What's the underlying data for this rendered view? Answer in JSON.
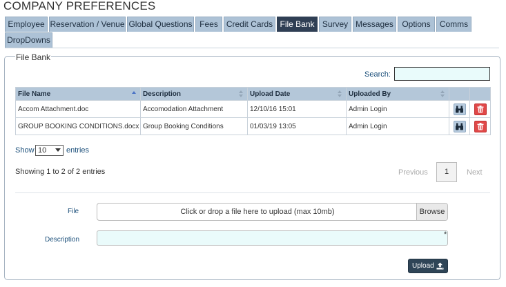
{
  "page_title": "COMPANY PREFERENCES",
  "tabs": [
    {
      "label": "Employee",
      "active": false
    },
    {
      "label": "Reservation / Venue",
      "active": false
    },
    {
      "label": "Global Questions",
      "active": false
    },
    {
      "label": "Fees",
      "active": false
    },
    {
      "label": "Credit Cards",
      "active": false
    },
    {
      "label": "File Bank",
      "active": true
    },
    {
      "label": "Survey",
      "active": false
    },
    {
      "label": "Messages",
      "active": false
    },
    {
      "label": "Options",
      "active": false
    },
    {
      "label": "Comms",
      "active": false
    },
    {
      "label": "DropDowns",
      "active": false
    }
  ],
  "panel": {
    "legend": "File Bank",
    "search": {
      "label": "Search:",
      "value": ""
    },
    "table": {
      "columns": [
        "File Name",
        "Description",
        "Upload Date",
        "Uploaded By"
      ],
      "sorted_column": "File Name",
      "sort_direction": "ascending",
      "rows": [
        {
          "file_name": "Accom Attachment.doc",
          "description": "Accomodation Attachment",
          "upload_date": "12/10/16 15:01",
          "uploaded_by": "Admin Login",
          "view_icon": "binoculars-icon",
          "delete_icon": "trash-icon"
        },
        {
          "file_name": "GROUP BOOKING CONDITIONS.docx",
          "description": "Group Booking Conditions",
          "upload_date": "01/03/19 13:05",
          "uploaded_by": "Admin Login",
          "view_icon": "binoculars-icon",
          "delete_icon": "trash-icon"
        }
      ]
    },
    "length": {
      "show_label": "Show",
      "value": "10",
      "entries_label": "entries"
    },
    "info": "Showing 1 to 2 of 2 entries",
    "pagination": {
      "previous": "Previous",
      "current": "1",
      "next": "Next"
    },
    "upload": {
      "file_label": "File",
      "drop_text": "Click or drop a file here to upload (max 10mb)",
      "browse_label": "Browse",
      "description_label": "Description",
      "description_value": "",
      "required_mark": "*",
      "upload_label": "Upload",
      "upload_icon": "upload-icon"
    }
  },
  "colors": {
    "tab_inactive": "#adc2d6",
    "tab_active": "#2f3f54",
    "header_bg": "#b4c7d9",
    "delete_red": "#e04848",
    "input_bg": "#eafbfb",
    "upload_button": "#2f4557"
  }
}
